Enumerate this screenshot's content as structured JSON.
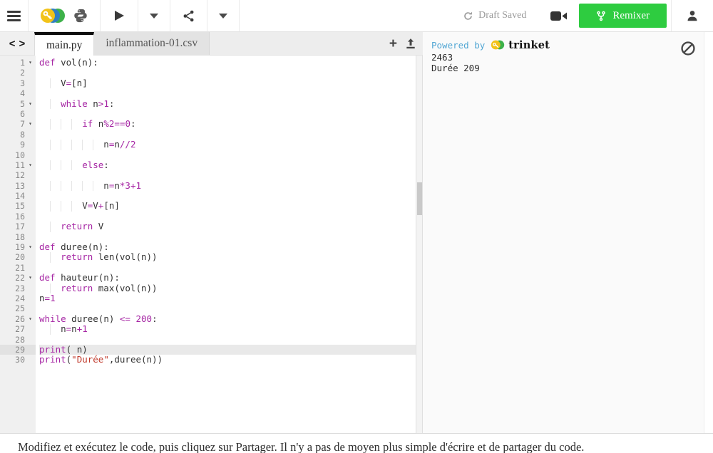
{
  "toolbar": {
    "draft_status": "Draft Saved",
    "remix_label": "Remixer"
  },
  "tabs": [
    {
      "label": "main.py",
      "active": true
    },
    {
      "label": "inflammation-01.csv",
      "active": false
    }
  ],
  "icons": {
    "plus": "+",
    "fold": "▾",
    "nav_left": "<",
    "nav_right": ">"
  },
  "editor": {
    "active_line": 29,
    "lines": [
      {
        "n": 1,
        "fold": true,
        "ind": 0,
        "segs": [
          [
            "k",
            "def"
          ],
          [
            "d",
            " vol(n):"
          ]
        ]
      },
      {
        "n": 2,
        "ind": 0,
        "segs": []
      },
      {
        "n": 3,
        "ind": 4,
        "segs": [
          [
            "d",
            "V"
          ],
          [
            "o",
            "="
          ],
          [
            "d",
            "[n]"
          ]
        ]
      },
      {
        "n": 4,
        "ind": 0,
        "segs": []
      },
      {
        "n": 5,
        "fold": true,
        "ind": 4,
        "segs": [
          [
            "k",
            "while"
          ],
          [
            "d",
            " n"
          ],
          [
            "o",
            ">"
          ],
          [
            "n",
            "1"
          ],
          [
            "d",
            ":"
          ]
        ]
      },
      {
        "n": 6,
        "ind": 0,
        "segs": []
      },
      {
        "n": 7,
        "fold": true,
        "ind": 8,
        "segs": [
          [
            "k",
            "if"
          ],
          [
            "d",
            " n"
          ],
          [
            "o",
            "%"
          ],
          [
            "n",
            "2"
          ],
          [
            "o",
            "=="
          ],
          [
            "n",
            "0"
          ],
          [
            "d",
            ":"
          ]
        ]
      },
      {
        "n": 8,
        "ind": 0,
        "segs": []
      },
      {
        "n": 9,
        "ind": 12,
        "segs": [
          [
            "d",
            "n"
          ],
          [
            "o",
            "="
          ],
          [
            "d",
            "n"
          ],
          [
            "o",
            "//"
          ],
          [
            "n",
            "2"
          ]
        ]
      },
      {
        "n": 10,
        "ind": 0,
        "segs": []
      },
      {
        "n": 11,
        "fold": true,
        "ind": 8,
        "segs": [
          [
            "k",
            "else"
          ],
          [
            "d",
            ":"
          ]
        ]
      },
      {
        "n": 12,
        "ind": 0,
        "segs": []
      },
      {
        "n": 13,
        "ind": 12,
        "segs": [
          [
            "d",
            "n"
          ],
          [
            "o",
            "="
          ],
          [
            "d",
            "n"
          ],
          [
            "o",
            "*"
          ],
          [
            "n",
            "3"
          ],
          [
            "o",
            "+"
          ],
          [
            "n",
            "1"
          ]
        ]
      },
      {
        "n": 14,
        "ind": 0,
        "segs": []
      },
      {
        "n": 15,
        "ind": 8,
        "segs": [
          [
            "d",
            "V"
          ],
          [
            "o",
            "="
          ],
          [
            "d",
            "V"
          ],
          [
            "o",
            "+"
          ],
          [
            "d",
            "[n]"
          ]
        ]
      },
      {
        "n": 16,
        "ind": 0,
        "segs": []
      },
      {
        "n": 17,
        "ind": 4,
        "segs": [
          [
            "k",
            "return"
          ],
          [
            "d",
            " V"
          ]
        ]
      },
      {
        "n": 18,
        "ind": 0,
        "segs": []
      },
      {
        "n": 19,
        "fold": true,
        "ind": 0,
        "segs": [
          [
            "k",
            "def"
          ],
          [
            "d",
            " duree(n):"
          ]
        ]
      },
      {
        "n": 20,
        "ind": 4,
        "segs": [
          [
            "k",
            "return"
          ],
          [
            "d",
            " len(vol(n))"
          ]
        ]
      },
      {
        "n": 21,
        "ind": 0,
        "segs": []
      },
      {
        "n": 22,
        "fold": true,
        "ind": 0,
        "segs": [
          [
            "k",
            "def"
          ],
          [
            "d",
            " hauteur(n):"
          ]
        ]
      },
      {
        "n": 23,
        "ind": 4,
        "segs": [
          [
            "k",
            "return"
          ],
          [
            "d",
            " max(vol(n))"
          ]
        ]
      },
      {
        "n": 24,
        "ind": 0,
        "segs": [
          [
            "d",
            "n"
          ],
          [
            "o",
            "="
          ],
          [
            "n",
            "1"
          ]
        ]
      },
      {
        "n": 25,
        "ind": 0,
        "segs": []
      },
      {
        "n": 26,
        "fold": true,
        "ind": 0,
        "segs": [
          [
            "k",
            "while"
          ],
          [
            "d",
            " duree(n) "
          ],
          [
            "o",
            "<="
          ],
          [
            "d",
            " "
          ],
          [
            "n",
            "200"
          ],
          [
            "d",
            ":"
          ]
        ]
      },
      {
        "n": 27,
        "ind": 4,
        "segs": [
          [
            "d",
            "n"
          ],
          [
            "o",
            "="
          ],
          [
            "d",
            "n"
          ],
          [
            "o",
            "+"
          ],
          [
            "n",
            "1"
          ]
        ]
      },
      {
        "n": 28,
        "ind": 0,
        "segs": []
      },
      {
        "n": 29,
        "ind": 0,
        "segs": [
          [
            "k",
            "print"
          ],
          [
            "d",
            "( n)"
          ]
        ]
      },
      {
        "n": 30,
        "ind": 0,
        "segs": [
          [
            "k",
            "print"
          ],
          [
            "d",
            "("
          ],
          [
            "s",
            "\"Durée\""
          ],
          [
            "d",
            ",duree(n))"
          ]
        ]
      }
    ]
  },
  "output": {
    "powered_by": "Powered by",
    "brand": "trinket",
    "lines": [
      "2463",
      "Durée 209"
    ]
  },
  "footer": {
    "message": "Modifiez et exécutez le code, puis cliquez sur Partager. Il n'y a pas de moyen plus simple d'écrire et de partager du code."
  },
  "colors": {
    "remix_green": "#2ecc40",
    "keyword_purple": "#a626a4",
    "string_red": "#c0392b",
    "powered_blue": "#53a7d4",
    "logo_yellow": "#f2c319",
    "logo_blue": "#2f7fc1",
    "logo_green": "#3db14a"
  }
}
